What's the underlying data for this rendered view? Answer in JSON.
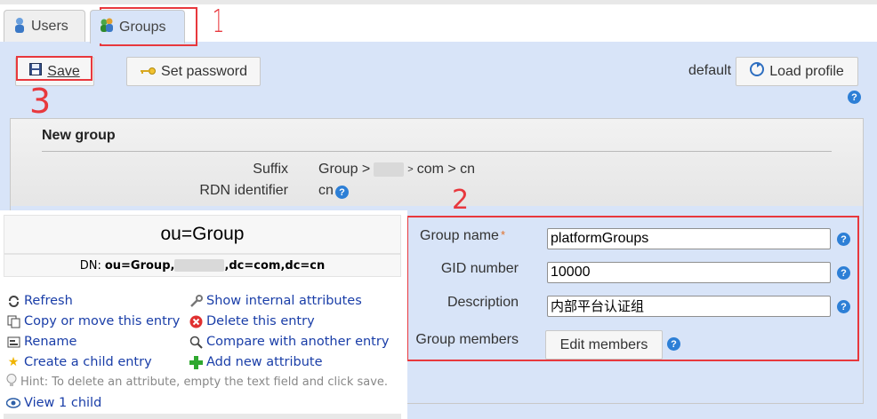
{
  "tabs": {
    "users": "Users",
    "groups": "Groups"
  },
  "toolbar": {
    "save": "Save",
    "set_password": "Set password",
    "profile_name": "default",
    "load_profile": "Load profile"
  },
  "annotations": {
    "one": "1",
    "two": "2",
    "three": "3"
  },
  "panel": {
    "title": "New group",
    "suffix_label": "Suffix",
    "suffix_value_prefix": "Group >",
    "suffix_value_suffix": "com > cn",
    "rdn_label": "RDN identifier",
    "rdn_value": "cn"
  },
  "form": {
    "group_name_label": "Group name",
    "required_mark": "*",
    "group_name_value": "platformGroups",
    "gid_label": "GID number",
    "gid_value": "10000",
    "description_label": "Description",
    "description_value": "内部平台认证组",
    "members_label": "Group members",
    "edit_members": "Edit members"
  },
  "entry": {
    "title": "ou=Group",
    "dn_label": "DN:",
    "dn_prefix": "ou=Group,",
    "dn_suffix": ",dc=com,dc=cn",
    "actions": {
      "refresh": "Refresh",
      "show_internal": "Show internal attributes",
      "copy_move": "Copy or move this entry",
      "delete": "Delete this entry",
      "rename": "Rename",
      "compare": "Compare with another entry",
      "create_child": "Create a child entry",
      "add_attribute": "Add new attribute",
      "hint": "Hint: To delete an attribute, empty the text field and click save.",
      "view_child": "View 1 child"
    }
  },
  "colors": {
    "accent_blue": "#2d7fd6",
    "annotation_red": "#e8383d",
    "link_blue": "#1a3ea8",
    "main_bg": "#d8e4f8"
  }
}
